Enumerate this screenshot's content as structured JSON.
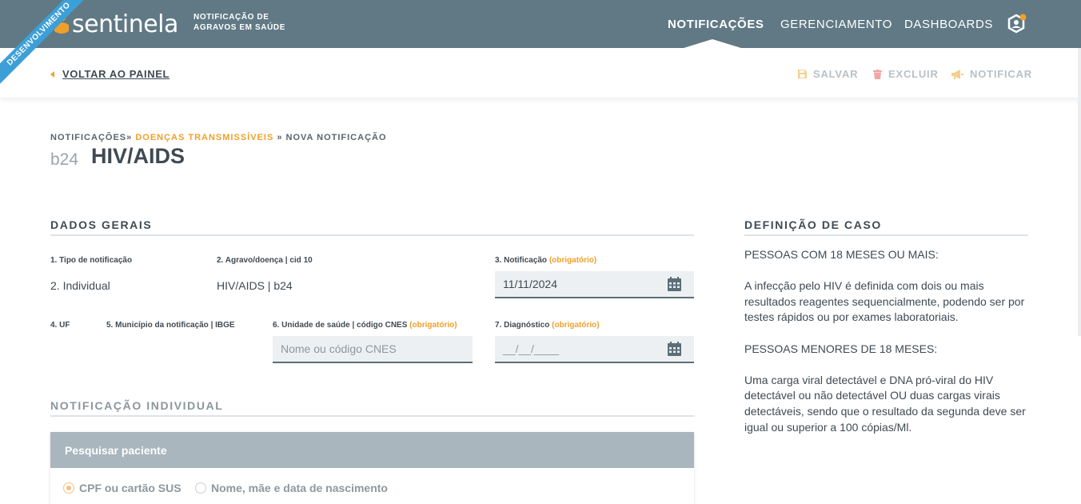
{
  "header": {
    "ribbon": "DESENVOLVIMENTO",
    "logo": "sentinela",
    "subtitle_line1": "NOTIFICAÇÃO DE",
    "subtitle_line2": "AGRAVOS EM SAÚDE",
    "nav": [
      "NOTIFICAÇÕES",
      "GERENCIAMENTO",
      "DASHBOARDS"
    ],
    "active_nav": "NOTIFICAÇÕES",
    "user_icon": "user-badge-icon"
  },
  "toolbar": {
    "back_label": "VOLTAR AO PAINEL",
    "save_label": "SALVAR",
    "delete_label": "EXCLUIR",
    "notify_label": "NOTIFICAR"
  },
  "breadcrumb": {
    "item1": "NOTIFICAÇÕES",
    "sep1": "» ",
    "item2": "DOENÇAS TRANSMISSÍVEIS",
    "sep2": " » ",
    "item3": "NOVA NOTIFICAÇÃO"
  },
  "page": {
    "code": "b24",
    "title": "HIV/AIDS"
  },
  "dados_gerais": {
    "heading": "DADOS GERAIS",
    "f1_label": "1. Tipo de notificação",
    "f1_value": "2. Individual",
    "f2_label": "2. Agravo/doença | cid 10",
    "f2_value": "HIV/AIDS | b24",
    "f3_label": "3. Notificação",
    "f3_req": "(obrigatório)",
    "f3_value": "11/11/2024",
    "f4_label": "4. UF",
    "f5_label": "5. Município da notificação | IBGE",
    "f6_label": "6. Unidade de saúde | código CNES",
    "f6_req": "(obrigatório)",
    "f6_placeholder": "Nome ou código CNES",
    "f7_label": "7. Diagnóstico",
    "f7_req": "(obrigatório)",
    "f7_placeholder": "__/__/____"
  },
  "definicao": {
    "heading": "DEFINIÇÃO DE CASO",
    "p1": "PESSOAS COM 18 MESES OU MAIS:",
    "p2": "A infecção pelo HIV é definida com dois ou mais resultados reagentes sequencialmente, podendo ser por testes rápidos ou por exames laboratoriais.",
    "p3": "PESSOAS MENORES DE 18 MESES:",
    "p4": "Uma carga viral detectável e DNA pró-viral do HIV detectável ou não detectável OU duas cargas virais detectáveis, sendo que o resultado da segunda deve ser igual ou superior a 100 cópias/Ml."
  },
  "notificacao_individual": {
    "heading": "NOTIFICAÇÃO INDIVIDUAL",
    "card_title": "Pesquisar paciente",
    "radio1": "CPF ou cartão SUS",
    "radio2": "Nome, mãe e data de nascimento",
    "selected": "CPF ou cartão SUS"
  },
  "colors": {
    "header_bg": "#607985",
    "accent": "#f0a02a",
    "ribbon": "#3c9fd8"
  }
}
